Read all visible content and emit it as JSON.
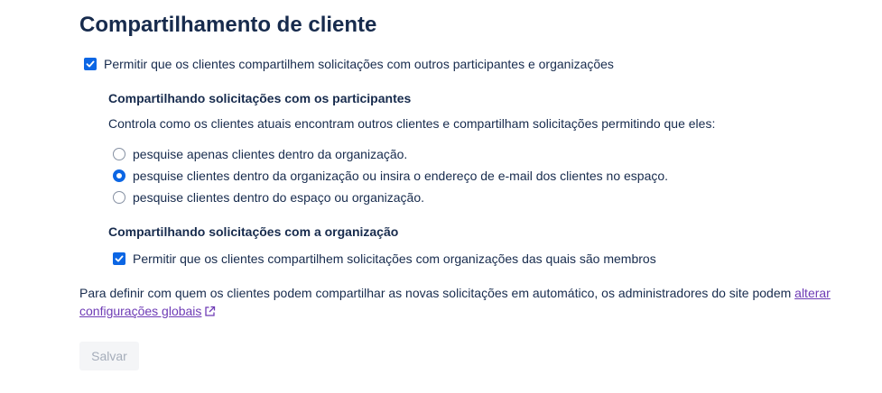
{
  "page": {
    "title": "Compartilhamento de cliente"
  },
  "main_option": {
    "label": "Permitir que os clientes compartilhem solicitações com outros participantes e organizações",
    "checked": true
  },
  "participants_section": {
    "heading": "Compartilhando solicitações com os participantes",
    "description": "Controla como os clientes atuais encontram outros clientes e compartilham solicitações permitindo que eles:",
    "options": [
      {
        "label": "pesquise apenas clientes dentro da organização.",
        "checked": false
      },
      {
        "label": "pesquise clientes dentro da organização ou insira o endereço de e-mail dos clientes no espaço.",
        "checked": true
      },
      {
        "label": "pesquise clientes dentro do espaço ou organização.",
        "checked": false
      }
    ]
  },
  "organization_section": {
    "heading": "Compartilhando solicitações com a organização",
    "option": {
      "label": "Permitir que os clientes compartilhem solicitações com organizações das quais são membros",
      "checked": true
    }
  },
  "footer": {
    "text": "Para definir com quem os clientes podem compartilhar as novas solicitações em automático, os administradores do site podem ",
    "link_label": "alterar configurações globais",
    "link_icon": "external-link-icon"
  },
  "actions": {
    "save_label": "Salvar",
    "save_disabled": true
  },
  "colors": {
    "accent": "#0c66e4",
    "link": "#6e3bb5",
    "text": "#172b4d",
    "disabled_bg": "#f4f5f7",
    "disabled_text": "#a5adba"
  }
}
